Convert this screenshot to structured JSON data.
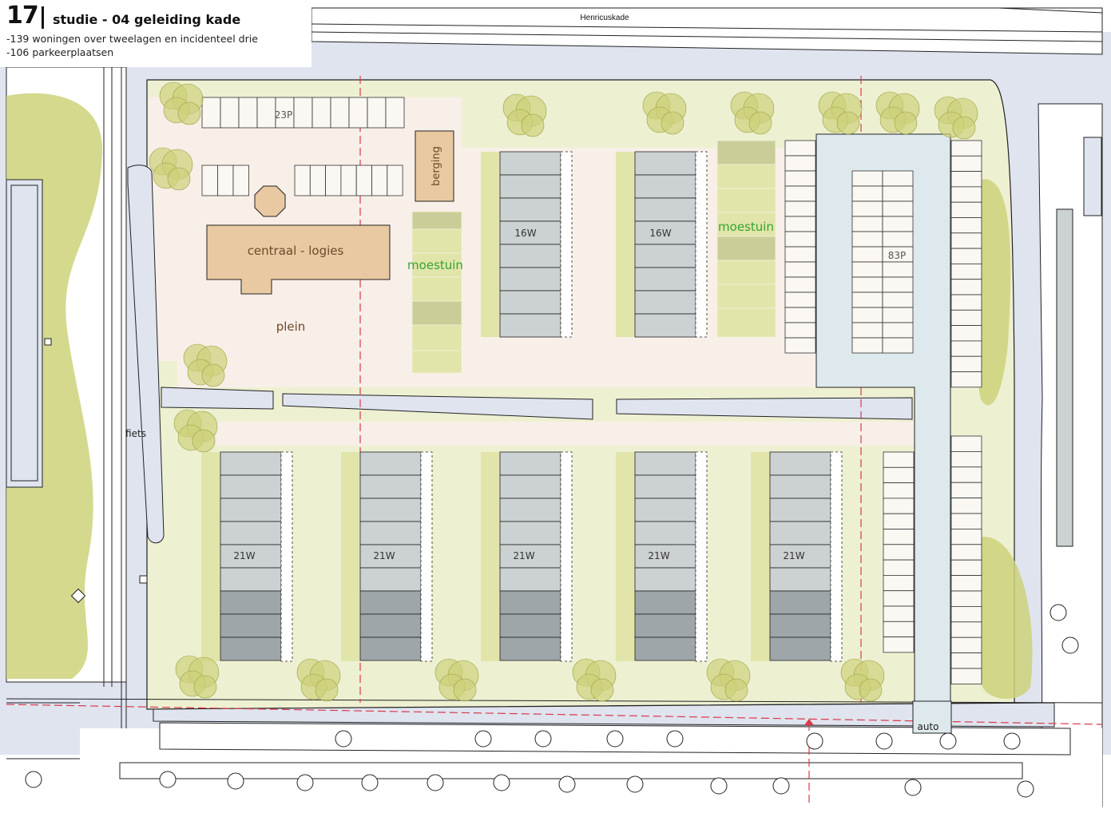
{
  "header": {
    "number": "17",
    "title": "studie - 04 geleiding kade",
    "lines": [
      "-139 woningen over tweelagen en incidenteel drie",
      "-106 parkeerplaatsen"
    ]
  },
  "streets": {
    "top": "Henricuskade"
  },
  "labels": {
    "parking_top": "23P",
    "parking_right": "83P",
    "storage": "berging",
    "central": "centraal - logies",
    "square": "plein",
    "garden_left": "moestuin",
    "garden_right": "moestuin",
    "bike": "fiets",
    "car": "auto"
  },
  "blocks": {
    "north": [
      "16W",
      "16W"
    ],
    "south": [
      "21W",
      "21W",
      "21W",
      "21W",
      "21W"
    ]
  },
  "colors": {
    "water": "#dfe4ef",
    "green": "#eef0d2",
    "plaza": "#f8efe8",
    "tree": "#cdd27a",
    "housing": "#ccd1d3",
    "housing_dark": "#9fa6a9",
    "building": "#e9c9a1",
    "parking_lane": "#dde9ec",
    "garden": "#e1e5aa",
    "garden_dark": "#cacd98",
    "accent": "#d93a4a",
    "garden_text": "#35a335"
  }
}
